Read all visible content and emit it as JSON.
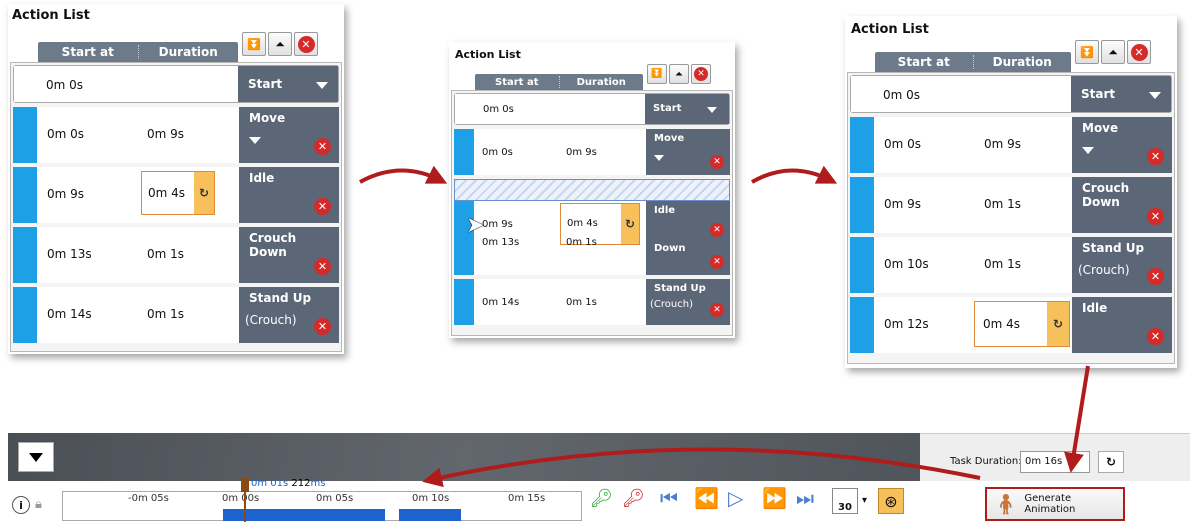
{
  "panels": [
    {
      "title": "Action List",
      "header": {
        "start_at": "Start at",
        "duration": "Duration"
      },
      "start_row": {
        "time": "0m 0s",
        "action": "Start"
      },
      "rows": [
        {
          "start": "0m 0s",
          "duration": "0m 9s",
          "action_line1": "Move",
          "action_line2": ""
        },
        {
          "start": "0m 9s",
          "duration": "0m 4s",
          "action_line1": "Idle",
          "action_line2": ""
        },
        {
          "start": "0m 13s",
          "duration": "0m 1s",
          "action_line1": "Crouch",
          "action_line2": "Down"
        },
        {
          "start": "0m 14s",
          "duration": "0m 1s",
          "action_line1": "Stand Up",
          "action_line2": "(Crouch)"
        }
      ]
    },
    {
      "title": "Action List",
      "header": {
        "start_at": "Start at",
        "duration": "Duration"
      },
      "start_row": {
        "time": "0m 0s",
        "action": "Start"
      },
      "rows": [
        {
          "start": "0m 0s",
          "duration": "0m 9s",
          "action_line1": "Move",
          "action_line2": ""
        },
        {
          "start": "0m 9s",
          "duration": "0m 4s",
          "action_line1": "Idle",
          "action_line2": ""
        },
        {
          "start": "0m 13s",
          "duration": "0m 1s",
          "action_line1": "Down",
          "action_line2": ""
        },
        {
          "start": "0m 14s",
          "duration": "0m 1s",
          "action_line1": "Stand Up",
          "action_line2": "(Crouch)"
        }
      ]
    },
    {
      "title": "Action List",
      "header": {
        "start_at": "Start at",
        "duration": "Duration"
      },
      "start_row": {
        "time": "0m 0s",
        "action": "Start"
      },
      "rows": [
        {
          "start": "0m 0s",
          "duration": "0m 9s",
          "action_line1": "Move",
          "action_line2": ""
        },
        {
          "start": "0m 9s",
          "duration": "0m 1s",
          "action_line1": "Crouch",
          "action_line2": "Down"
        },
        {
          "start": "0m 10s",
          "duration": "0m 1s",
          "action_line1": "Stand Up",
          "action_line2": "(Crouch)"
        },
        {
          "start": "0m 12s",
          "duration": "0m 4s",
          "action_line1": "Idle",
          "action_line2": ""
        }
      ]
    }
  ],
  "task": {
    "duration_label": "Task Duration:",
    "duration_value": "0m 16s",
    "generate_label": "Generate Animation"
  },
  "timeline": {
    "playhead_time": "0m 01s",
    "playhead_ms": "212",
    "playhead_ms_unit": "ms",
    "ticks": [
      "-0m 05s",
      "0m 00s",
      "0m 05s",
      "0m 10s",
      "0m 15s"
    ],
    "frame_rate": "30"
  },
  "colors": {
    "accent_blue": "#1ea0e6",
    "action_bg": "#5b6676",
    "arrow_red": "#b01c1c",
    "highlight_orange": "#f7c05a"
  }
}
